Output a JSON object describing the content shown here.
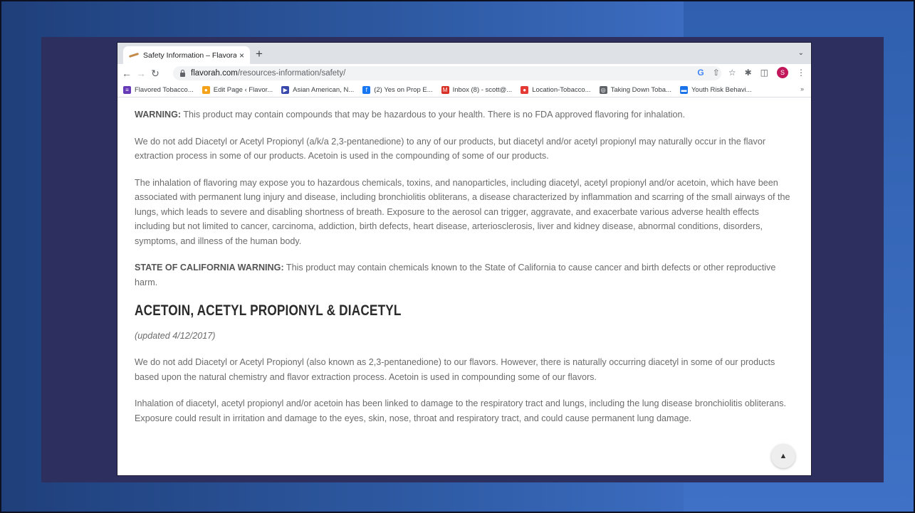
{
  "browser": {
    "tab_title": "Safety Information – Flavorah F",
    "tab_close": "×",
    "new_tab": "+",
    "tab_menu": "⌄",
    "url_host": "flavorah.com",
    "url_path": "/resources-information/safety/",
    "google_icon": "G",
    "avatar_letter": "S"
  },
  "bookmarks": {
    "items": [
      {
        "label": "Flavored Tobacco...",
        "icon": "form-icon",
        "color": "#673ab7"
      },
      {
        "label": "Edit Page ‹ Flavor...",
        "icon": "search-icon",
        "color": "#f4a21a"
      },
      {
        "label": "Asian American, N...",
        "icon": "play-icon",
        "color": "#3949ab"
      },
      {
        "label": "(2) Yes on Prop E...",
        "icon": "facebook-icon",
        "color": "#1877f2"
      },
      {
        "label": "Inbox (8) - scott@...",
        "icon": "gmail-icon",
        "color": "#d93025"
      },
      {
        "label": "Location-Tobacco...",
        "icon": "circle-icon",
        "color": "#e53935"
      },
      {
        "label": "Taking Down Toba...",
        "icon": "globe-icon",
        "color": "#5f6368"
      },
      {
        "label": "Youth Risk Behavi...",
        "icon": "flag-icon",
        "color": "#1a73e8"
      }
    ],
    "more": "»"
  },
  "content": {
    "warning_label": "WARNING:",
    "warning_text": " This product may contain compounds that may be hazardous to your health. There is no FDA approved flavoring for inhalation.",
    "para1": "We do not add Diacetyl or Acetyl Propionyl (a/k/a 2,3-pentanedione) to any of our products, but diacetyl and/or acetyl propionyl may naturally occur in the flavor extraction process in some of our products. Acetoin is used in the compounding of some of our products.",
    "para2": "The inhalation of flavoring may expose you to hazardous chemicals, toxins, and nanoparticles, including diacetyl, acetyl propionyl and/or acetoin, which have been associated with permanent lung injury and disease, including bronchiolitis obliterans, a disease characterized by inflammation and scarring of the small airways of the lungs, which leads to severe and disabling shortness of breath. Exposure to the aerosol can trigger, aggravate, and exacerbate various adverse health effects including but not limited to cancer, carcinoma, addiction, birth defects, heart disease, arteriosclerosis, liver and kidney disease, abnormal conditions, disorders, symptoms, and illness of the human body.",
    "ca_label": "STATE OF CALIFORNIA WARNING:",
    "ca_text": " This product may contain chemicals known to the State of California to cause cancer and birth defects or other reproductive harm.",
    "heading": "Acetoin, Acetyl Propionyl & Diacetyl",
    "updated": "(updated 4/12/2017)",
    "para3": "We do not add Diacetyl or Acetyl Propionyl (also known as 2,3-pentanedione) to our flavors. However, there is naturally occurring diacetyl in some of our products based upon the natural chemistry and flavor extraction process. Acetoin is used in compounding some of our flavors.",
    "para4": "Inhalation of diacetyl, acetyl propionyl and/or acetoin has been linked to damage to the respiratory tract and lungs, including the lung disease bronchiolitis obliterans. Exposure could result in irritation and damage to the eyes, skin, nose, throat and respiratory tract, and could cause permanent lung damage."
  }
}
